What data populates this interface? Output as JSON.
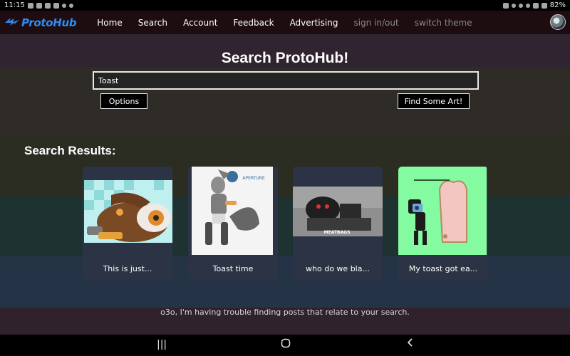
{
  "status_bar": {
    "time": "11:15",
    "battery": "82%"
  },
  "nav": {
    "brand": "ProtoHub",
    "links": [
      "Home",
      "Search",
      "Account",
      "Feedback",
      "Advertising"
    ],
    "muted_links": [
      "sign in/out",
      "switch theme"
    ]
  },
  "search": {
    "title": "Search ProtoHub!",
    "value": "Toast",
    "options_label": "Options",
    "find_label": "Find Some Art!"
  },
  "results": {
    "title": "Search Results:",
    "items": [
      {
        "caption": "This is just..."
      },
      {
        "caption": "Toast time"
      },
      {
        "caption": "who do we bla..."
      },
      {
        "caption": "My toast got ea..."
      }
    ],
    "thumb3_text": "MEATBAGS",
    "thumb2_logo": "APERTURE"
  },
  "footer_message": "o3o, I'm having trouble finding posts that relate to your search.",
  "colors": {
    "brand_blue": "#2f8cf0",
    "card_bg": "#2c3345",
    "navbar_bg": "#1d0c10"
  },
  "icons": {
    "recents": "recents-icon",
    "home": "home-icon",
    "back": "back-icon"
  }
}
